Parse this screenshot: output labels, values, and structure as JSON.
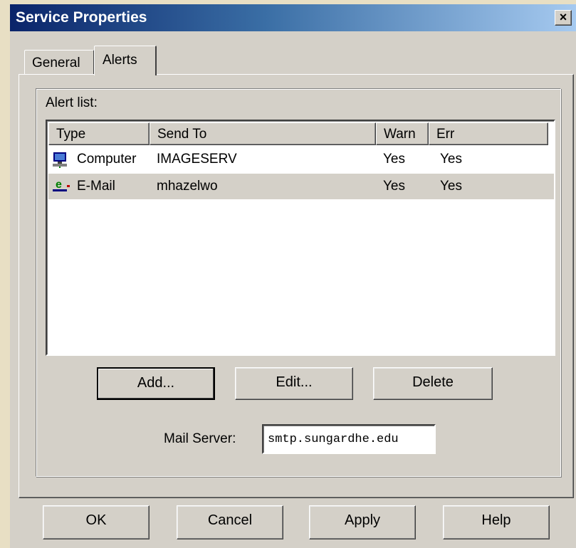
{
  "window": {
    "title": "Service Properties",
    "close_label": "×"
  },
  "tabs": [
    {
      "label": "General",
      "active": false
    },
    {
      "label": "Alerts",
      "active": true
    }
  ],
  "alerts": {
    "group_label": "Alert list:",
    "columns": [
      "Type",
      "Send To",
      "Warn",
      "Err"
    ],
    "rows": [
      {
        "icon": "computer-icon",
        "type": "Computer",
        "send_to": "IMAGESERV",
        "warn": "Yes",
        "err": "Yes",
        "selected": false
      },
      {
        "icon": "email-icon",
        "type": "E-Mail",
        "send_to": "mhazelwo",
        "warn": "Yes",
        "err": "Yes",
        "selected": true
      }
    ],
    "buttons": {
      "add": "Add...",
      "edit": "Edit...",
      "delete": "Delete"
    },
    "mail_server_label": "Mail Server:",
    "mail_server_value": "smtp.sungardhe.edu"
  },
  "footer": {
    "ok": "OK",
    "cancel": "Cancel",
    "apply": "Apply",
    "help": "Help"
  },
  "colors": {
    "titlebar_start": "#0a246a",
    "titlebar_end": "#a6caf0",
    "face": "#d4d0c8",
    "email_icon_green": "#008000"
  }
}
